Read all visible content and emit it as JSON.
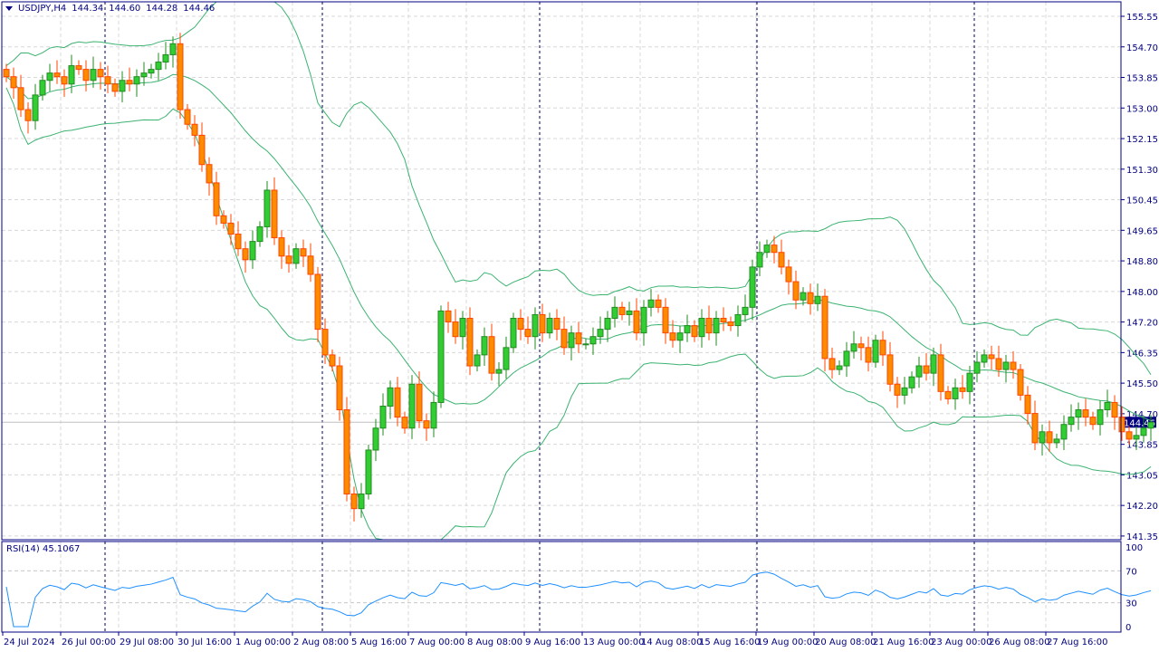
{
  "header": {
    "symbol": "USDJPY,H4",
    "open": "144.34",
    "high": "144.60",
    "low": "144.28",
    "close": "144.46",
    "menu_icon": "triangle-down-icon"
  },
  "rsi": {
    "label": "RSI(14) 45.1067",
    "levels": [
      "100",
      "70",
      "30",
      "0"
    ]
  },
  "price_axis": [
    "155.55",
    "154.70",
    "153.85",
    "153.00",
    "152.15",
    "151.30",
    "150.45",
    "149.65",
    "148.80",
    "148.00",
    "147.20",
    "146.35",
    "145.50",
    "144.70",
    "143.85",
    "143.05",
    "142.20",
    "141.35"
  ],
  "current_price": "144.46",
  "time_axis": [
    "24 Jul 2024",
    "26 Jul 00:00",
    "29 Jul 08:00",
    "30 Jul 16:00",
    "1 Aug 00:00",
    "2 Aug 08:00",
    "5 Aug 16:00",
    "7 Aug 00:00",
    "8 Aug 08:00",
    "9 Aug 16:00",
    "13 Aug 00:00",
    "14 Aug 08:00",
    "15 Aug 16:00",
    "19 Aug 00:00",
    "20 Aug 08:00",
    "21 Aug 16:00",
    "23 Aug 00:00",
    "26 Aug 08:00",
    "27 Aug 16:00"
  ],
  "colors": {
    "bull": "#32cd32",
    "bull_border": "#228b22",
    "bear": "#ff8c00",
    "bear_border": "#ff4500",
    "bands": "#3cb371",
    "rsi": "#1e90ff",
    "axis": "#000080"
  },
  "chart_data": {
    "type": "candlestick",
    "title": "USDJPY,H4",
    "ylim": [
      141.35,
      155.55
    ],
    "rsi_range": [
      0,
      100
    ],
    "closes": [
      153.9,
      153.6,
      153.0,
      152.7,
      153.4,
      153.8,
      154.0,
      153.9,
      153.7,
      154.2,
      154.1,
      153.8,
      154.1,
      153.9,
      153.7,
      153.5,
      153.8,
      153.7,
      153.9,
      154.0,
      154.1,
      154.3,
      154.5,
      154.8,
      153.0,
      152.6,
      152.3,
      151.5,
      151.0,
      150.1,
      149.9,
      149.6,
      149.2,
      148.9,
      149.4,
      149.8,
      150.8,
      149.5,
      149.0,
      148.8,
      149.2,
      149.0,
      148.5,
      147.0,
      146.3,
      146.0,
      144.8,
      142.5,
      142.1,
      142.5,
      143.7,
      144.3,
      144.9,
      145.4,
      144.6,
      144.3,
      145.5,
      144.5,
      144.3,
      145.0,
      147.5,
      147.2,
      146.8,
      147.3,
      146.0,
      146.3,
      146.8,
      145.8,
      145.9,
      146.5,
      147.3,
      147.0,
      146.8,
      147.4,
      146.9,
      147.3,
      147.0,
      146.5,
      146.9,
      146.6,
      146.6,
      146.8,
      147.0,
      147.3,
      147.6,
      147.4,
      147.5,
      146.9,
      147.6,
      147.8,
      147.6,
      146.9,
      146.7,
      146.9,
      147.1,
      146.8,
      147.3,
      146.9,
      147.3,
      147.2,
      147.1,
      147.4,
      147.6,
      148.7,
      149.1,
      149.3,
      149.1,
      148.7,
      148.3,
      147.8,
      148.0,
      147.7,
      147.9,
      146.2,
      145.9,
      146.0,
      146.4,
      146.6,
      146.5,
      146.1,
      146.7,
      146.3,
      145.5,
      145.2,
      145.4,
      145.7,
      146.0,
      145.8,
      146.3,
      145.3,
      145.1,
      145.4,
      145.3,
      145.8,
      146.1,
      146.3,
      146.2,
      145.9,
      146.1,
      145.9,
      145.2,
      144.7,
      143.9,
      144.2,
      143.9,
      144.0,
      144.4,
      144.6,
      144.8,
      144.6,
      144.4,
      144.8,
      145.0,
      144.6,
      144.2,
      144.0,
      144.1,
      144.3,
      144.46
    ],
    "indicators": [
      "Bollinger Bands(20,2)",
      "RSI(14)"
    ]
  }
}
